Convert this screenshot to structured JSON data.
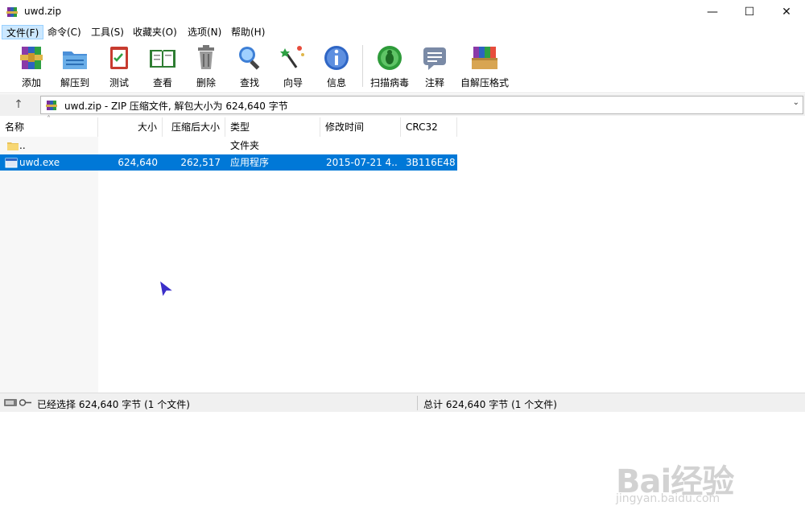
{
  "titlebar": {
    "title": "uwd.zip"
  },
  "menu": [
    {
      "label": "文件(F)",
      "active": true
    },
    {
      "label": "命令(C)"
    },
    {
      "label": "工具(S)"
    },
    {
      "label": "收藏夹(O)"
    },
    {
      "label": "选项(N)"
    },
    {
      "label": "帮助(H)"
    }
  ],
  "toolbar": [
    {
      "label": "添加",
      "icon": "add-icon"
    },
    {
      "label": "解压到",
      "icon": "extract-to-icon"
    },
    {
      "label": "测试",
      "icon": "test-icon"
    },
    {
      "label": "查看",
      "icon": "view-icon"
    },
    {
      "label": "删除",
      "icon": "delete-icon"
    },
    {
      "label": "查找",
      "icon": "find-icon"
    },
    {
      "label": "向导",
      "icon": "wizard-icon"
    },
    {
      "label": "信息",
      "icon": "info-icon"
    },
    {
      "label": "扫描病毒",
      "icon": "scan-virus-icon"
    },
    {
      "label": "注释",
      "icon": "comment-icon"
    },
    {
      "label": "自解压格式",
      "icon": "sfx-icon"
    }
  ],
  "address": {
    "text": "uwd.zip - ZIP 压缩文件, 解包大小为 624,640 字节"
  },
  "columns": {
    "name": "名称",
    "size": "大小",
    "packed": "压缩后大小",
    "type": "类型",
    "modified": "修改时间",
    "crc": "CRC32"
  },
  "rows": [
    {
      "name": "..",
      "size": "",
      "packed": "",
      "type": "文件夹",
      "modified": "",
      "crc": "",
      "icon": "folder-icon"
    },
    {
      "name": "uwd.exe",
      "size": "624,640",
      "packed": "262,517",
      "type": "应用程序",
      "modified": "2015-07-21 4...",
      "crc": "3B116E48",
      "icon": "exe-icon",
      "selected": true
    }
  ],
  "status": {
    "left": "已经选择 624,640 字节 (1 个文件)",
    "right": "总计 624,640 字节 (1 个文件)"
  },
  "watermark": {
    "logo": "Bai经验",
    "sub": "jingyan.baidu.com"
  },
  "colors": {
    "selection": "#0078d7",
    "menu_active": "#cce8ff"
  }
}
